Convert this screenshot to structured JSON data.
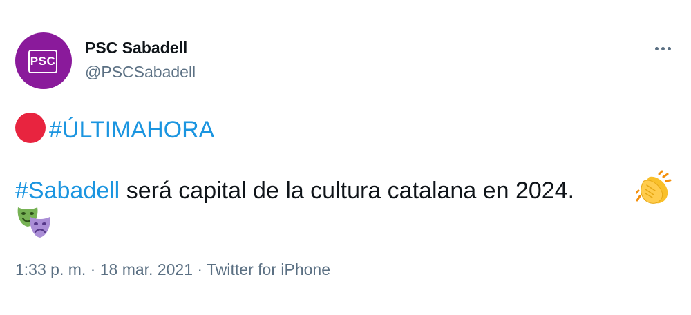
{
  "account": {
    "avatar_text": "PSC",
    "display_name": "PSC Sabadell",
    "handle": "@PSCSabadell"
  },
  "menu": {
    "icon": "more-horizontal-icon"
  },
  "tweet": {
    "line1": {
      "emoji_icon": "red-circle-icon",
      "hashtag": "#ÚLTIMAHORA"
    },
    "line2": {
      "hashtag": "#Sabadell",
      "text": " será capital de la cultura catalana en 2024.",
      "trailing_emoji_icon": "clapping-hands-icon"
    },
    "line3": {
      "emoji_icon": "performing-arts-icon"
    }
  },
  "meta": {
    "time": "1:33 p. m.",
    "separator": " · ",
    "date": "18 mar. 2021",
    "source": "Twitter for iPhone"
  },
  "colors": {
    "avatar_bg": "#8a1a9b",
    "link": "#1b95e0",
    "secondary_text": "#5b7083",
    "red_circle": "#e8243f"
  }
}
